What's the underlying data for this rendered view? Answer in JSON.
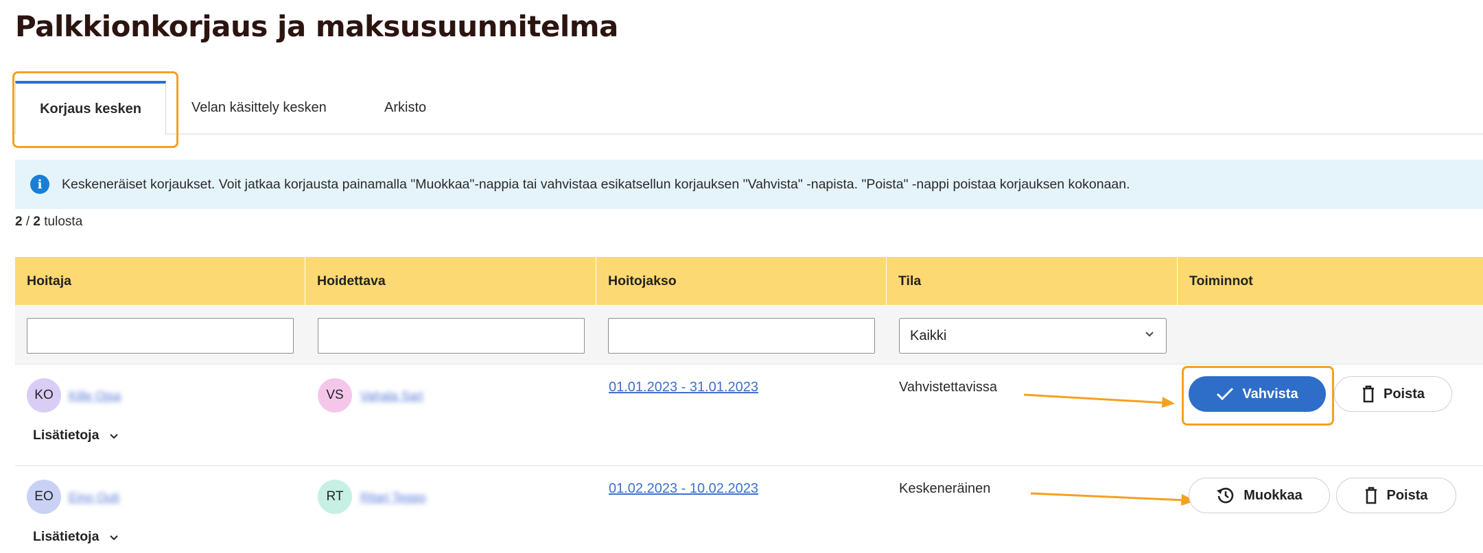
{
  "page": {
    "title": "Palkkionkorjaus ja maksusuunnitelma"
  },
  "tabs": [
    {
      "label": "Korjaus kesken",
      "active": true
    },
    {
      "label": "Velan käsittely kesken",
      "active": false
    },
    {
      "label": "Arkisto",
      "active": false
    }
  ],
  "info": {
    "icon": "info-icon",
    "text": "Keskeneräiset korjaukset. Voit jatkaa korjausta painamalla \"Muokkaa\"-nappia tai vahvistaa esikatsellun korjauksen \"Vahvista\" -napista. \"Poista\" -nappi poistaa korjauksen kokonaan."
  },
  "results": {
    "shown": "2",
    "separator": "/",
    "total": "2",
    "suffix": "tulosta"
  },
  "table": {
    "headers": [
      "Hoitaja",
      "Hoidettava",
      "Hoitojakso",
      "Tila",
      "Toiminnot"
    ],
    "filters": {
      "hoitaja": "",
      "hoidettava": "",
      "hoitojakso": "",
      "tila_selected": "Kaikki"
    },
    "rows": [
      {
        "hoitaja_initials": "KO",
        "hoitaja_name": "Kille Ojsa",
        "hoidettava_initials": "VS",
        "hoidettava_name": "Vahala Sari",
        "period": "01.01.2023 - 31.01.2023",
        "status": "Vahvistettavissa",
        "more": "Lisätietoja",
        "primary_action": "Vahvista",
        "delete_action": "Poista"
      },
      {
        "hoitaja_initials": "EO",
        "hoitaja_name": "Eino Outi",
        "hoidettava_initials": "RT",
        "hoidettava_name": "Ritari Teppo",
        "period": "01.02.2023 - 10.02.2023",
        "status": "Keskeneräinen",
        "more": "Lisätietoja",
        "primary_action": "Muokkaa",
        "delete_action": "Poista"
      }
    ]
  },
  "colors": {
    "header_bg": "#fdd974",
    "primary": "#2e6ec8",
    "highlight": "#f4a11e",
    "info_bg": "#e5f4fb",
    "avatar_ko": "#d9cdf5",
    "avatar_vs": "#f4c7ea",
    "avatar_eo": "#c9d2f5",
    "avatar_rt": "#c6f0e3"
  }
}
